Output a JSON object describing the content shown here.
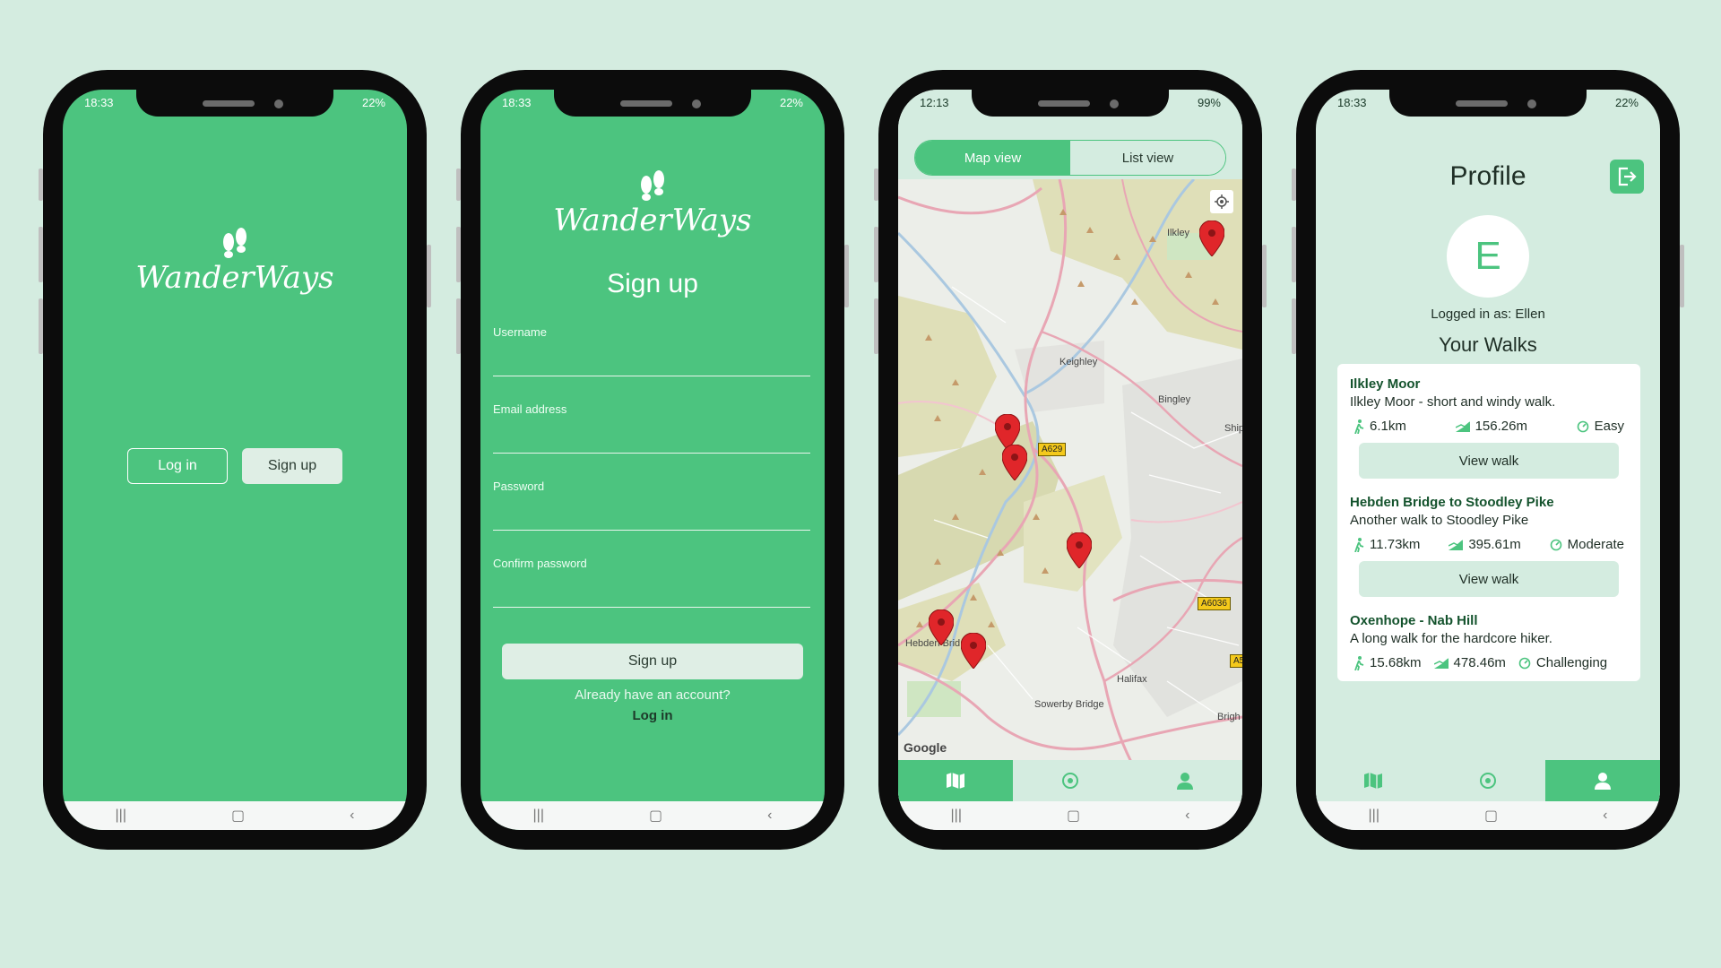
{
  "brand": {
    "name": "WanderWays"
  },
  "screen1": {
    "status_time": "18:33",
    "status_battery": "22%",
    "login_label": "Log in",
    "signup_label": "Sign up"
  },
  "screen2": {
    "status_time": "18:33",
    "status_battery": "22%",
    "title": "Sign up",
    "fields": [
      {
        "label": "Username"
      },
      {
        "label": "Email address"
      },
      {
        "label": "Password"
      },
      {
        "label": "Confirm password"
      }
    ],
    "submit_label": "Sign up",
    "already_text": "Already have an account?",
    "login_link": "Log in"
  },
  "screen3": {
    "status_time": "12:13",
    "status_battery": "99%",
    "tabs": {
      "map": "Map view",
      "list": "List view"
    },
    "places": [
      "Ilkley",
      "Keighley",
      "Bingley",
      "Ship",
      "Hebden Brid",
      "Halifax",
      "Sowerby Bridge",
      "Brigh"
    ],
    "roads": [
      "A629",
      "A6036",
      "A5"
    ],
    "attribution": "Google"
  },
  "screen4": {
    "status_time": "18:33",
    "status_battery": "22%",
    "title": "Profile",
    "avatar_initial": "E",
    "logged_in": "Logged in as: Ellen",
    "walks_heading": "Your Walks",
    "walks": [
      {
        "name": "Ilkley Moor",
        "desc": "Ilkley Moor - short and windy walk.",
        "distance": "6.1km",
        "elevation": "156.26m",
        "difficulty": "Easy",
        "action": "View walk"
      },
      {
        "name": "Hebden Bridge to Stoodley Pike",
        "desc": "Another walk to Stoodley Pike",
        "distance": "11.73km",
        "elevation": "395.61m",
        "difficulty": "Moderate",
        "action": "View walk"
      },
      {
        "name": "Oxenhope - Nab Hill",
        "desc": "A long walk for the hardcore hiker.",
        "distance": "15.68km",
        "elevation": "478.46m",
        "difficulty": "Challenging"
      }
    ]
  },
  "colors": {
    "accent": "#4cc47f",
    "background": "#d4ece0",
    "marker": "#e0262a"
  }
}
